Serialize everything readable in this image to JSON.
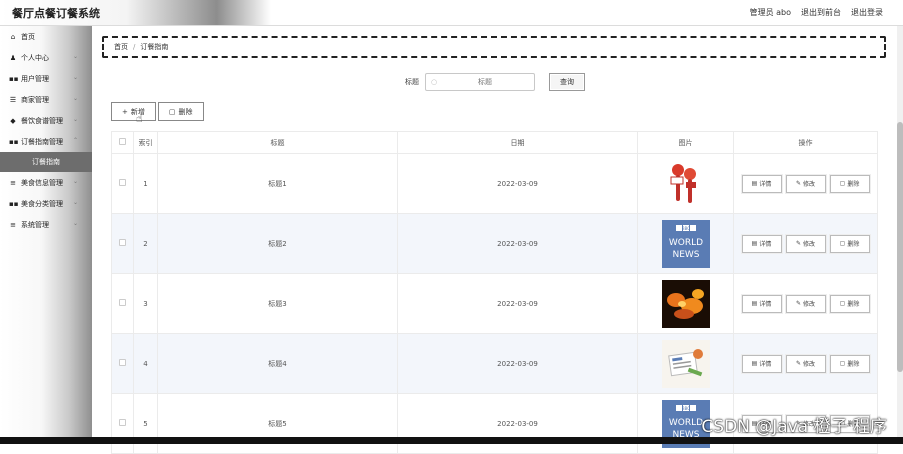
{
  "header": {
    "title": "餐厅点餐订餐系统",
    "user": "管理员 abo",
    "front": "退出到前台",
    "logout": "退出登录"
  },
  "sidebar": {
    "items": [
      {
        "icon": "home-icon",
        "label": "首页"
      },
      {
        "icon": "user-icon",
        "label": "个人中心"
      },
      {
        "icon": "grid-icon",
        "label": "用户管理"
      },
      {
        "icon": "sliders-icon",
        "label": "商家管理"
      },
      {
        "icon": "tag-icon",
        "label": "餐饮食谱管理"
      },
      {
        "icon": "grid-icon",
        "label": "订餐指南管理"
      }
    ],
    "active_sub": "订餐指南",
    "items_after": [
      {
        "icon": "list-icon",
        "label": "美食信息管理"
      },
      {
        "icon": "grid-icon",
        "label": "美食分类管理"
      },
      {
        "icon": "list-icon",
        "label": "系统管理"
      }
    ]
  },
  "breadcrumb": {
    "home": "首页",
    "sep": "/",
    "current": "订餐指南"
  },
  "search": {
    "label": "标题",
    "placeholder": "标题",
    "button": "查询"
  },
  "actions": {
    "add": "新增",
    "delete": "删除"
  },
  "table": {
    "headers": [
      "索引",
      "标题",
      "日期",
      "图片",
      "操作"
    ],
    "rows": [
      {
        "index": "1",
        "title": "标题1",
        "date": "2022-03-09",
        "image": "microphones"
      },
      {
        "index": "2",
        "title": "标题2",
        "date": "2022-03-09",
        "image": "bbc-world-news"
      },
      {
        "index": "3",
        "title": "标题3",
        "date": "2022-03-09",
        "image": "fire-text"
      },
      {
        "index": "4",
        "title": "标题4",
        "date": "2022-03-09",
        "image": "newspaper"
      },
      {
        "index": "5",
        "title": "标题5",
        "date": "2022-03-09",
        "image": "bbc-world-news"
      }
    ],
    "ops": {
      "detail": "详情",
      "edit": "修改",
      "delete": "删除"
    }
  },
  "bbc": {
    "logo": "BBC",
    "line1": "WORLD",
    "line2": "NEWS"
  },
  "watermark": "CSDN @Java  橙子  程序",
  "colors": {
    "sidebar_active": "#6d6d6d",
    "row_alt": "#f3f6fb",
    "bbc_blue": "#5a7cb4",
    "mic_red": "#d93a2b"
  }
}
